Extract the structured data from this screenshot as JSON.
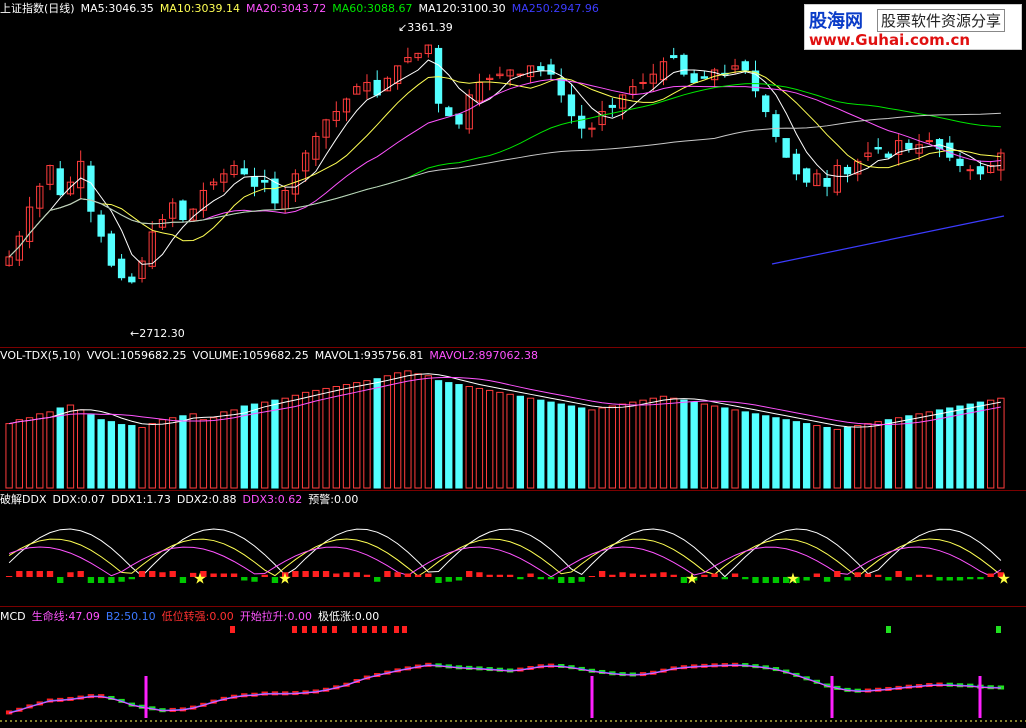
{
  "header": {
    "main": [
      {
        "text": "上证指数(日线)",
        "color": "#ffffff"
      },
      {
        "text": "MA5:3046.35",
        "color": "#ffffff"
      },
      {
        "text": "MA10:3039.14",
        "color": "#ffff54"
      },
      {
        "text": "MA20:3043.72",
        "color": "#ff54ff"
      },
      {
        "text": "MA60:3088.67",
        "color": "#00e600"
      },
      {
        "text": "MA120:3100.30",
        "color": "#ffffff"
      },
      {
        "text": "MA250:2947.96",
        "color": "#3c3cff"
      }
    ],
    "volume": [
      {
        "text": "VOL-TDX(5,10)",
        "color": "#ffffff"
      },
      {
        "text": "VVOL:1059682.25",
        "color": "#ffffff"
      },
      {
        "text": "VOLUME:1059682.25",
        "color": "#ffffff"
      },
      {
        "text": "MAVOL1:935756.81",
        "color": "#ffffff"
      },
      {
        "text": "MAVOL2:897062.38",
        "color": "#ff54ff"
      }
    ],
    "ddx": [
      {
        "text": "破解DDX",
        "color": "#ffffff"
      },
      {
        "text": "DDX:0.07",
        "color": "#ffffff"
      },
      {
        "text": "DDX1:1.73",
        "color": "#ffffff"
      },
      {
        "text": "DDX2:0.88",
        "color": "#ffffff"
      },
      {
        "text": "DDX3:0.62",
        "color": "#ff54ff"
      },
      {
        "text": "预警:0.00",
        "color": "#ffffff"
      }
    ],
    "mcd": [
      {
        "text": "MCD",
        "color": "#ffffff"
      },
      {
        "text": "生命线:47.09",
        "color": "#ff54ff"
      },
      {
        "text": "B2:50.10",
        "color": "#3c78ff"
      },
      {
        "text": "低位转强:0.00",
        "color": "#ff3030"
      },
      {
        "text": "开始拉升:0.00",
        "color": "#ff54ff"
      },
      {
        "text": "极低涨:0.00",
        "color": "#ffffff"
      }
    ]
  },
  "annotations": {
    "high": "3361.39",
    "low": "2712.30"
  },
  "logo": {
    "brand": "股海网",
    "slogan": "股票软件资源分享",
    "url": "www.Guhai.com.cn"
  },
  "colors": {
    "up": "#ff3c3c",
    "down": "#54ffff",
    "background": "#000000",
    "divider": "#7a0000"
  },
  "chart_data": {
    "type": "candlestick",
    "title": "上证指数(日线)",
    "price_range": [
      2640,
      3420
    ],
    "high_label": 3361.39,
    "low_label": 2712.3,
    "closes": [
      2840,
      2890,
      2960,
      3010,
      3060,
      2990,
      3020,
      3070,
      2950,
      2890,
      2820,
      2790,
      2780,
      2830,
      2900,
      2930,
      2970,
      2930,
      2955,
      3000,
      3020,
      3040,
      3060,
      3040,
      3010,
      3020,
      2970,
      3000,
      3040,
      3090,
      3130,
      3170,
      3190,
      3220,
      3250,
      3260,
      3230,
      3270,
      3300,
      3320,
      3330,
      3350,
      3210,
      3180,
      3160,
      3230,
      3260,
      3270,
      3280,
      3290,
      3280,
      3300,
      3290,
      3280,
      3230,
      3180,
      3150,
      3150,
      3190,
      3200,
      3230,
      3250,
      3260,
      3280,
      3310,
      3320,
      3280,
      3260,
      3270,
      3290,
      3280,
      3300,
      3290,
      3240,
      3190,
      3130,
      3080,
      3040,
      3020,
      3040,
      3010,
      3060,
      3040,
      3070,
      3090,
      3100,
      3080,
      3120,
      3100,
      3110,
      3120,
      3100,
      3080,
      3060,
      3050,
      3040,
      3060,
      3090
    ],
    "ma5_last": 3046.35,
    "ma10_last": 3039.14,
    "ma20_last": 3043.72,
    "ma60_last": 3088.67,
    "ma120_last": 3100.3,
    "ma250_last": 2947.96,
    "volume": {
      "range": [
        0,
        1250000
      ],
      "values": [
        660,
        700,
        720,
        760,
        780,
        820,
        850,
        800,
        750,
        700,
        680,
        650,
        640,
        620,
        660,
        700,
        720,
        740,
        760,
        700,
        720,
        780,
        800,
        840,
        860,
        880,
        900,
        920,
        950,
        980,
        1000,
        1020,
        1040,
        1060,
        1080,
        1100,
        1120,
        1150,
        1180,
        1200,
        1170,
        1150,
        1100,
        1080,
        1060,
        1040,
        1020,
        1000,
        980,
        960,
        940,
        920,
        900,
        880,
        860,
        840,
        820,
        800,
        820,
        840,
        860,
        880,
        900,
        920,
        940,
        920,
        900,
        880,
        860,
        840,
        820,
        800,
        780,
        760,
        740,
        720,
        700,
        680,
        660,
        640,
        620,
        600,
        620,
        640,
        660,
        680,
        700,
        720,
        740,
        760,
        780,
        800,
        820,
        840,
        860,
        880,
        900,
        920
      ],
      "vvol_last": 1059682.25,
      "mavol1_last": 935756.81,
      "mavol2_last": 897062.38
    },
    "ddx": {
      "ddx": 0.07,
      "ddx1": 1.73,
      "ddx2": 0.88,
      "ddx3": 0.62,
      "warning": 0.0
    },
    "mcd": {
      "lifeline": 47.09,
      "b2": 50.1,
      "low_turn_strong": 0.0,
      "start_rise": 0.0,
      "very_low_rise": 0.0
    }
  }
}
